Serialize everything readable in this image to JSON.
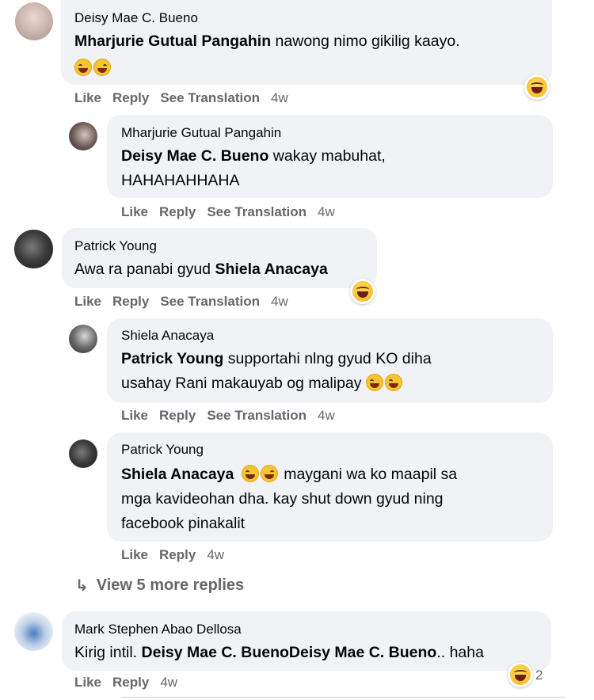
{
  "actions": {
    "like": "Like",
    "reply": "Reply",
    "see_translation": "See Translation"
  },
  "comments": [
    {
      "author": "Deisy Mae C. Bueno",
      "mention": "Mharjurie Gutual Pangahin",
      "text": " nawong nimo gikilig kaayo.",
      "time": "4w"
    },
    {
      "author": "Mharjurie Gutual Pangahin",
      "mention": "Deisy Mae C. Bueno",
      "text": " wakay mabuhat,",
      "text2": "HAHAHAHHAHA",
      "time": "4w"
    },
    {
      "author": "Patrick Young",
      "text": "Awa ra panabi gyud ",
      "mention": "Shiela Anacaya",
      "time": "4w"
    },
    {
      "author": "Shiela Anacaya",
      "mention": "Patrick Young",
      "text": " supportahi nlng gyud KO diha",
      "text2": "usahay Rani makauyab og malipay ",
      "time": "4w"
    },
    {
      "author": "Patrick Young",
      "mention": "Shiela Anacaya",
      "text": " maygani wa ko maapil sa",
      "text2": "mga kavideohan dha. kay shut down gyud ning",
      "text3": "facebook pinakalit",
      "time": "4w"
    },
    {
      "author": "Mark Stephen Abao Dellosa",
      "text": "Kirig intil. ",
      "mention": "Deisy Mae C. BuenoDeisy Mae C. Bueno",
      "text2": ".. haha",
      "time": "4w",
      "reaction_count": "2"
    }
  ],
  "view_more": "View 5 more replies",
  "icons": [
    "laughing-emoji-icon",
    "haha-reaction-icon",
    "reply-arrow-icon"
  ]
}
